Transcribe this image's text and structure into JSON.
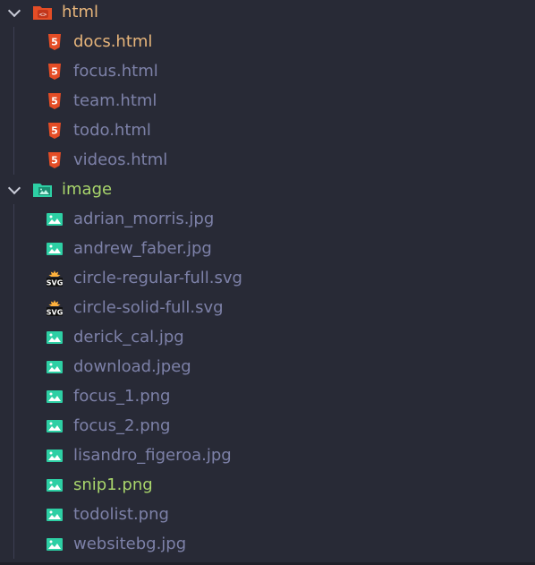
{
  "colors": {
    "background": "#282a36",
    "text_default": "#7d81a8",
    "text_modified": "#e7b57b",
    "text_untracked": "#a9d66c",
    "folder_html_text": "#e7b57b",
    "folder_image_text": "#a9d66c",
    "html_icon": "#e44d26",
    "image_icon": "#2dcfa4",
    "svg_icon_accent": "#ffb13b"
  },
  "explorer": {
    "folders": [
      {
        "name": "html",
        "icon": "html-folder-icon",
        "expanded": true,
        "files": [
          {
            "name": "docs.html",
            "icon": "html5-icon",
            "status": "modified"
          },
          {
            "name": "focus.html",
            "icon": "html5-icon",
            "status": "default"
          },
          {
            "name": "team.html",
            "icon": "html5-icon",
            "status": "default"
          },
          {
            "name": "todo.html",
            "icon": "html5-icon",
            "status": "default"
          },
          {
            "name": "videos.html",
            "icon": "html5-icon",
            "status": "default"
          }
        ]
      },
      {
        "name": "image",
        "icon": "image-folder-icon",
        "expanded": true,
        "files": [
          {
            "name": "adrian_morris.jpg",
            "icon": "image-icon",
            "status": "default"
          },
          {
            "name": "andrew_faber.jpg",
            "icon": "image-icon",
            "status": "default"
          },
          {
            "name": "circle-regular-full.svg",
            "icon": "svg-icon",
            "status": "default"
          },
          {
            "name": "circle-solid-full.svg",
            "icon": "svg-icon",
            "status": "default"
          },
          {
            "name": "derick_cal.jpg",
            "icon": "image-icon",
            "status": "default"
          },
          {
            "name": "download.jpeg",
            "icon": "image-icon",
            "status": "default"
          },
          {
            "name": "focus_1.png",
            "icon": "image-icon",
            "status": "default"
          },
          {
            "name": "focus_2.png",
            "icon": "image-icon",
            "status": "default"
          },
          {
            "name": "lisandro_figeroa.jpg",
            "icon": "image-icon",
            "status": "default"
          },
          {
            "name": "snip1.png",
            "icon": "image-icon",
            "status": "untracked"
          },
          {
            "name": "todolist.png",
            "icon": "image-icon",
            "status": "default"
          },
          {
            "name": "websitebg.jpg",
            "icon": "image-icon",
            "status": "default"
          }
        ]
      }
    ]
  }
}
